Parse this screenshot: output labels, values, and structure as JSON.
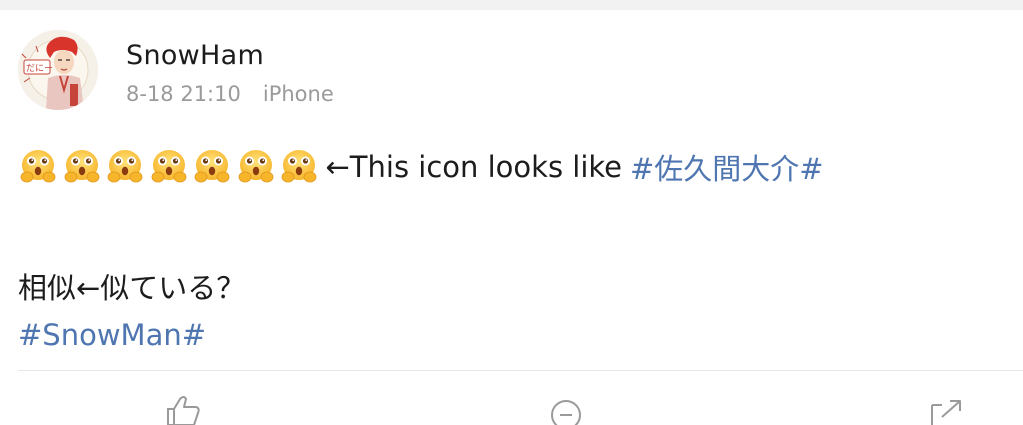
{
  "post": {
    "username": "SnowHam",
    "timestamp": "8-18 21:10",
    "source": "iPhone",
    "avatar_badge": "だにー",
    "emoji": {
      "name": "hug-emoji",
      "count": 7
    },
    "line1_text": "←This icon looks like",
    "line1_hashtag": "#佐久間大介#",
    "line2_text": "相似←似ている？",
    "line3_hashtag": "#SnowMan#"
  },
  "actions": [
    {
      "name": "like",
      "icon": "thumbs-up-icon"
    },
    {
      "name": "comment",
      "icon": "comment-icon"
    },
    {
      "name": "share",
      "icon": "share-icon"
    }
  ],
  "colors": {
    "hashtag": "#4f76b0",
    "text": "#1c1c1c",
    "meta": "#9a9a9a",
    "background": "#ffffff",
    "band": "#f2f2f2"
  }
}
